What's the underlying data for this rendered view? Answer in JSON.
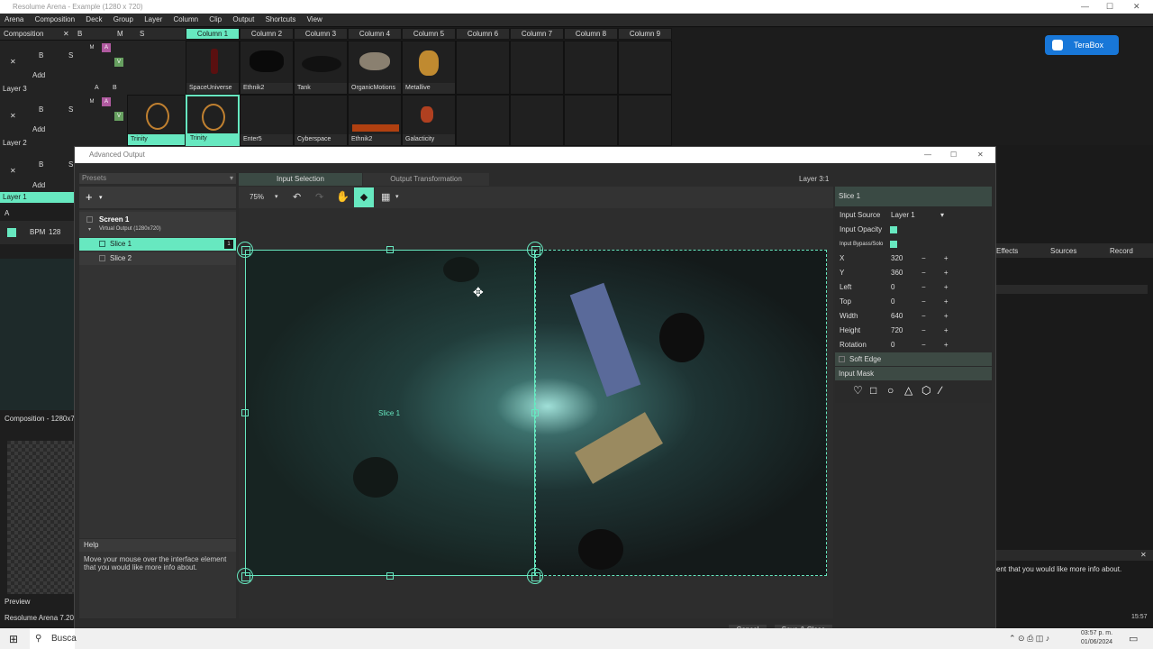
{
  "window": {
    "title": "Resolume Arena - Example (1280 x 720)"
  },
  "menu": [
    "Arena",
    "Composition",
    "Deck",
    "Group",
    "Layer",
    "Column",
    "Clip",
    "Output",
    "Shortcuts",
    "View"
  ],
  "composition": {
    "label": "Composition",
    "x": "✕",
    "b": "B"
  },
  "comp_btns": {
    "m": "M",
    "s": "S"
  },
  "columns": [
    "Column 1",
    "Column 2",
    "Column 3",
    "Column 4",
    "Column 5",
    "Column 6",
    "Column 7",
    "Column 8",
    "Column 9"
  ],
  "layers": [
    {
      "name": "Layer 3",
      "clips": [
        "SpaceUniverse",
        "Ethnik2",
        "Tank",
        "OrganicMotions",
        "Metallive"
      ]
    },
    {
      "name": "Layer 2",
      "clips": [
        "Trinity",
        "Trinity",
        "Enter5",
        "Cyberspace",
        "Ethnik2",
        "Galacticity"
      ]
    },
    {
      "name": "Layer 1"
    }
  ],
  "layer_ctrl": {
    "x": "✕",
    "b": "B",
    "s": "S",
    "add": "Add",
    "a": "A",
    "bb": "B",
    "m": "M",
    "v": "V"
  },
  "terabox": "TeraBox",
  "left_panel": {
    "a": "A",
    "bpm_label": "BPM",
    "bpm": "128",
    "comp_label": "Composition - 1280x7",
    "preview": "Preview",
    "version": "Resolume Arena 7.20"
  },
  "right_bg": {
    "tabs": [
      "Effects",
      "Sources",
      "Record"
    ],
    "help": "ent that you would like more info about."
  },
  "dialog": {
    "title": "Advanced Output",
    "presets": "Presets",
    "tabs": [
      "Input Selection",
      "Output Transformation"
    ],
    "layer_label": "Layer 3:1",
    "zoom": "75%",
    "tree": {
      "screen": "Screen 1",
      "virtual": "Virtual Output (1280x720)",
      "slices": [
        "Slice 1",
        "Slice 2"
      ],
      "slice_badge": "1"
    },
    "help_title": "Help",
    "help_text": "Move your mouse over the interface element that you would like more info about.",
    "slice_label": "Slice 1",
    "props": {
      "title": "Slice 1",
      "rows": [
        {
          "label": "Input Source",
          "value": "Layer 1"
        },
        {
          "label": "Input Opacity",
          "value": ""
        },
        {
          "label": "Input Bypass/Solo",
          "value": ""
        },
        {
          "label": "X",
          "value": "320"
        },
        {
          "label": "Y",
          "value": "360"
        },
        {
          "label": "Left",
          "value": "0"
        },
        {
          "label": "Top",
          "value": "0"
        },
        {
          "label": "Width",
          "value": "640"
        },
        {
          "label": "Height",
          "value": "720"
        },
        {
          "label": "Rotation",
          "value": "0"
        }
      ],
      "soft_edge": "Soft Edge",
      "input_mask": "Input Mask",
      "pm": "− +"
    },
    "cancel": "Cancel",
    "save": "Save & Close"
  },
  "taskbar": {
    "search": "Busca",
    "time": "03:57 p. m.",
    "date": "01/06/2024",
    "time2": "15:57"
  },
  "colors": {
    "accent": "#67e8c0",
    "bg": "#1a1a1a",
    "panel": "#2b2b2b"
  }
}
